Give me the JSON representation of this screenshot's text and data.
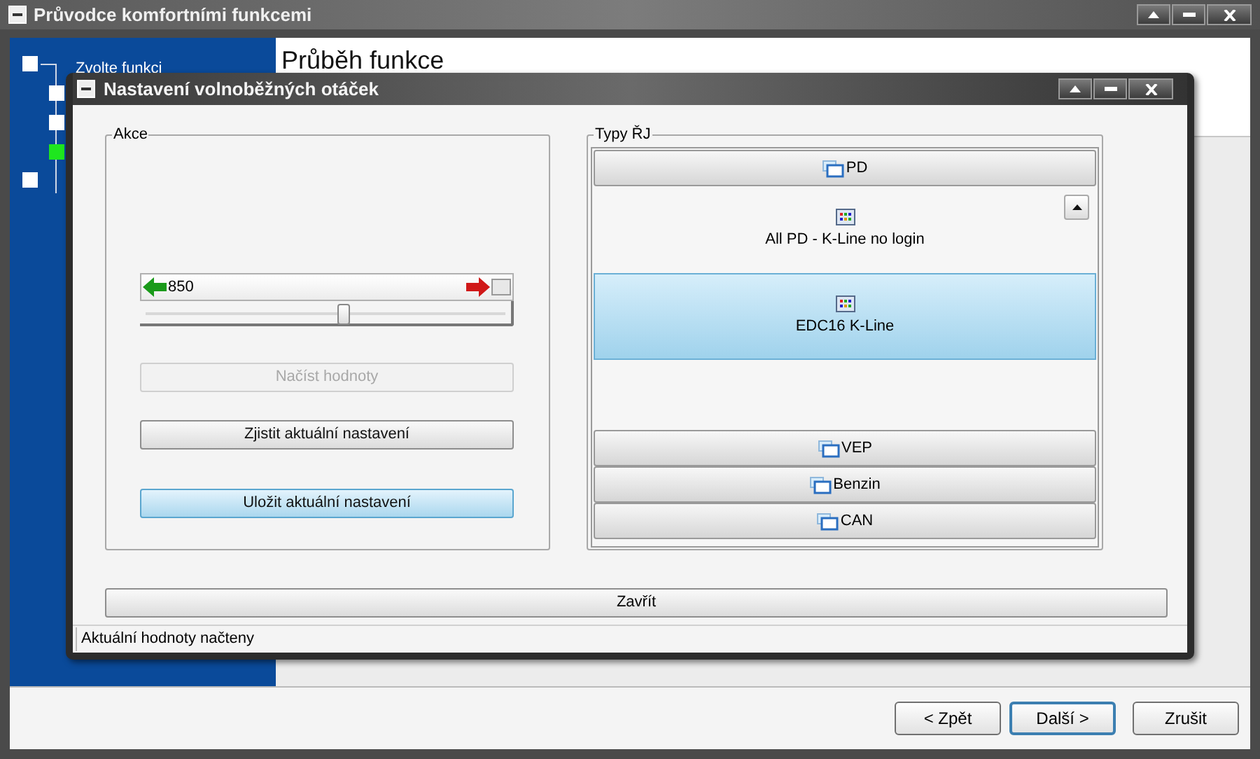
{
  "window": {
    "title": "Průvodce komfortními funkcemi"
  },
  "steps": [
    {
      "label": "Zvolte funkci",
      "current": false
    },
    {
      "current": false
    },
    {
      "current": false
    },
    {
      "current": true
    },
    {
      "current": false
    }
  ],
  "page": {
    "heading": "Průběh funkce"
  },
  "dialog": {
    "title": "Nastavení volnoběžných otáček",
    "actions": {
      "legend": "Akce",
      "slider": {
        "value": "850",
        "level": 0.55,
        "checked": false
      },
      "buttons": [
        {
          "label": "Načíst hodnoty",
          "disabled": true,
          "highlighted": false
        },
        {
          "label": "Zjistit aktuální nastavení",
          "disabled": false,
          "highlighted": false
        },
        {
          "label": "Uložit aktuální nastavení",
          "disabled": false,
          "highlighted": true
        }
      ]
    },
    "types": {
      "legend": "Typy ŘJ",
      "entries": [
        {
          "kind": "group",
          "label": "PD"
        },
        {
          "kind": "item",
          "label": "All PD - K-Line no login",
          "selected": false
        },
        {
          "kind": "item",
          "label": "EDC16 K-Line",
          "selected": true
        },
        {
          "kind": "spacer"
        },
        {
          "kind": "group",
          "label": "VEP"
        },
        {
          "kind": "group",
          "label": "Benzin"
        },
        {
          "kind": "group",
          "label": "CAN"
        }
      ]
    },
    "close_button": "Zavřít",
    "status": "Aktuální hodnoty načteny"
  },
  "nav_buttons": [
    {
      "label": "< Zpět",
      "default": false
    },
    {
      "label": "Další >",
      "default": true
    },
    {
      "label": "Zrušit",
      "default": false
    }
  ]
}
